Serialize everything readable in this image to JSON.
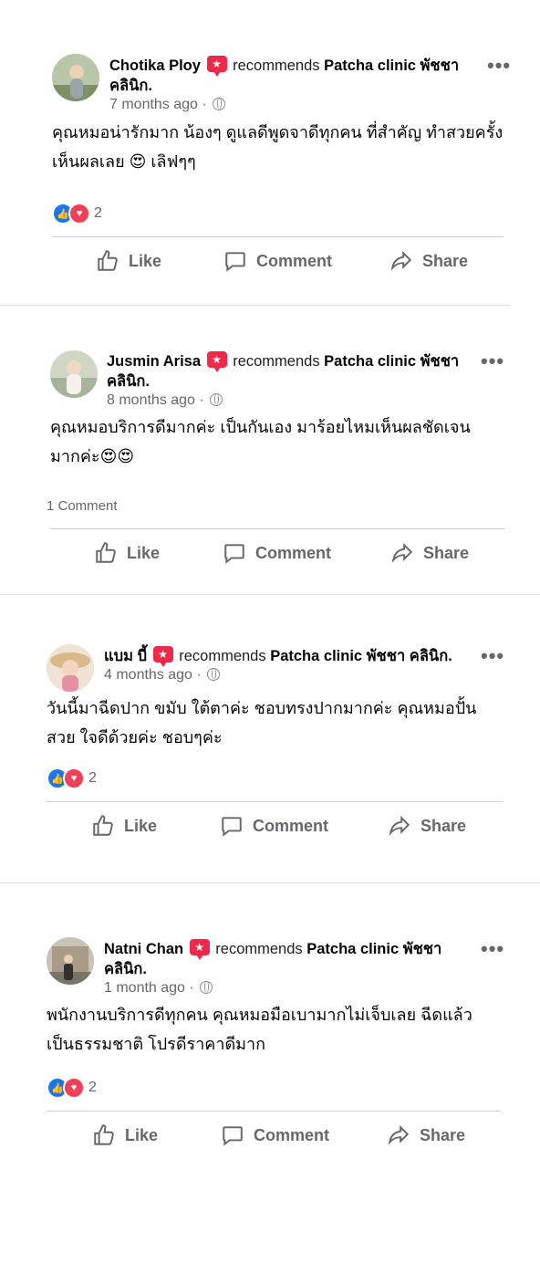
{
  "posts": [
    {
      "author": "Chotika Ploy",
      "verb": "recommends",
      "page_line1": "Patcha clinic พัชชา",
      "page_line2": "คลินิก.",
      "time": "7 months ago",
      "sep": "·",
      "text": "คุณหมอน่ารักมาก  น้องๆ ดูแลดีพูดจาดีทุกคน  ที่สำคัญ ทำสวยครั้งเห็นผลเลย 😍 เลิฟๆๆ",
      "reactions": "2",
      "comments": ""
    },
    {
      "author": "Jusmin Arisa",
      "verb": "recommends",
      "page_line1": "Patcha clinic พัชชา",
      "page_line2": "คลินิก.",
      "time": "8 months ago",
      "sep": "·",
      "text": "คุณหมอบริการดีมากค่ะ เป็นกันเอง มาร้อยไหมเห็นผลชัดเจนมากค่ะ😍😍",
      "reactions": "",
      "comments": "1 Comment"
    },
    {
      "author": "แบม บี้",
      "verb": "recommends",
      "page_line1": "Patcha clinic พัชชา คลินิก.",
      "page_line2": "",
      "time": "4 months ago",
      "sep": "·",
      "text": "วันนี้มาฉีดปาก ขมับ ใต้ตาค่ะ ชอบทรงปากมากค่ะ คุณหมอปั้นสวย ใจดีด้วยค่ะ ชอบๆค่ะ",
      "reactions": "2",
      "comments": ""
    },
    {
      "author": "Natni Chan",
      "verb": "recommends",
      "page_line1": "Patcha clinic พัชชา",
      "page_line2": "คลินิก.",
      "time": "1 month ago",
      "sep": "·",
      "text": "พนักงานบริการดีทุกคน คุณหมอมือเบามากไม่เจ็บเลย ฉีดแล้วเป็นธรรมชาติ โปรดีราคาดีมาก",
      "reactions": "2",
      "comments": ""
    }
  ],
  "actions": {
    "like": "Like",
    "comment": "Comment",
    "share": "Share"
  },
  "colors": {
    "like_blue": "#1877f2",
    "love_red": "#f33e58",
    "recommend_badge": "#f02849",
    "muted": "#65676b"
  }
}
